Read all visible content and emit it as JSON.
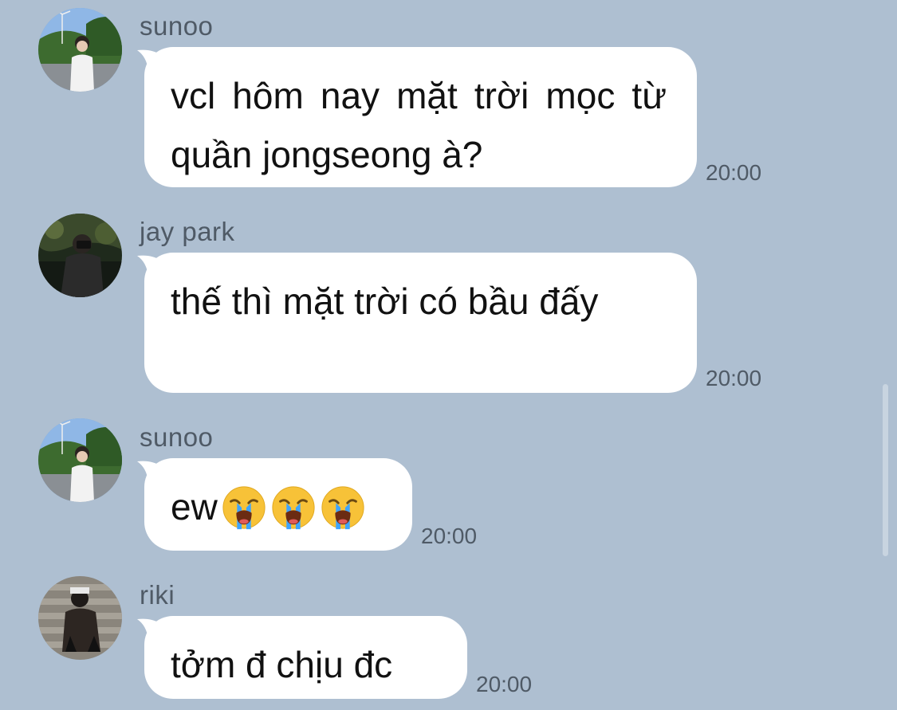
{
  "messages": [
    {
      "sender": "sunoo",
      "text": "vcl hôm nay mặt trời mọc từ quần jongseong à?",
      "time": "20:00",
      "avatar_icon": "sunoo-avatar-photo"
    },
    {
      "sender": "jay park",
      "text": "thế thì mặt trời có bầu đấy",
      "time": "20:00",
      "avatar_icon": "jay-avatar-photo"
    },
    {
      "sender": "sunoo",
      "text": "ew",
      "emoji": [
        "😭",
        "😭",
        "😭"
      ],
      "time": "20:00",
      "avatar_icon": "sunoo-avatar-photo"
    },
    {
      "sender": "riki",
      "text": "tởm đ chịu đc",
      "time": "20:00",
      "avatar_icon": "riki-avatar-photo"
    }
  ],
  "colors": {
    "background": "#aebfd1",
    "bubble": "#ffffff",
    "meta_text": "#4f5a66",
    "message_text": "#111111"
  }
}
